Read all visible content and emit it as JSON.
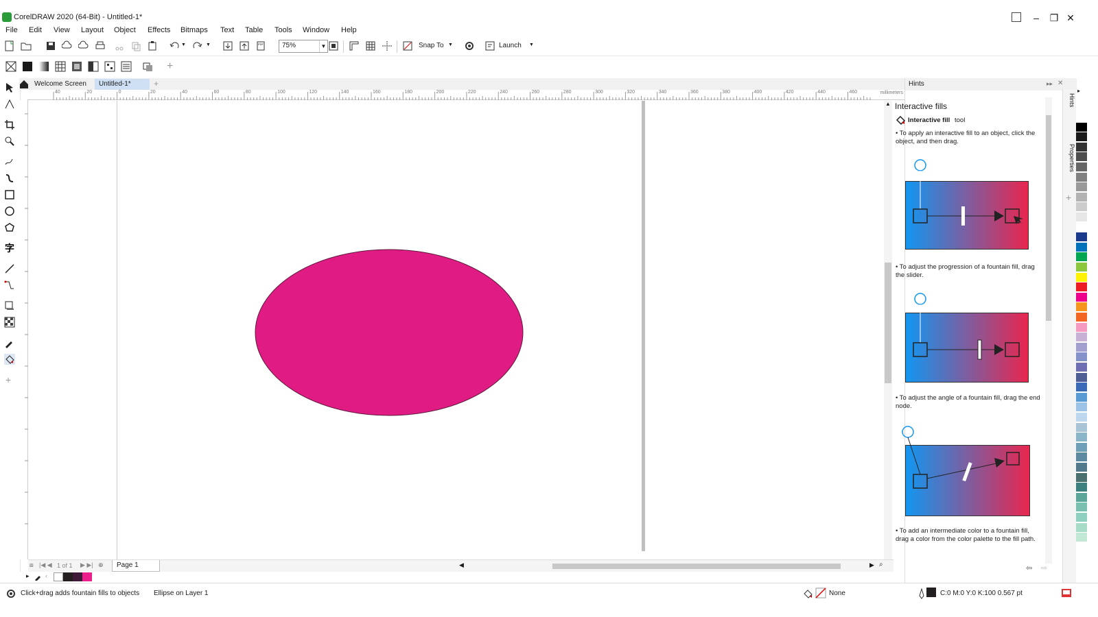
{
  "window": {
    "title": "CorelDRAW 2020 (64-Bit) - Untitled-1*",
    "buttons": [
      "–",
      "❐",
      "✕"
    ]
  },
  "menu": [
    "File",
    "Edit",
    "View",
    "Layout",
    "Object",
    "Effects",
    "Bitmaps",
    "Text",
    "Table",
    "Tools",
    "Window",
    "Help"
  ],
  "toolbar": {
    "zoom": "75%",
    "snap_label": "Snap To",
    "launch_label": "Launch"
  },
  "tabs": {
    "welcome": "Welcome Screen",
    "doc": "Untitled-1*",
    "add": "+"
  },
  "ruler": {
    "unit": "millimeters",
    "h_ticks": [
      "40",
      "20",
      "0",
      "20",
      "40",
      "60",
      "80",
      "100",
      "120",
      "140",
      "160",
      "180",
      "200",
      "220",
      "240",
      "260",
      "280",
      "300",
      "320",
      "340",
      "360",
      "380",
      "400",
      "420",
      "440",
      "460"
    ]
  },
  "hints": {
    "panel_title": "Hints",
    "heading": "Interactive fills",
    "tool_name": "Interactive fill",
    "tool_suffix": "tool",
    "bullet1": "• To apply an interactive fill to an object, click the object, and then drag.",
    "bullet2": "• To adjust the progression of a fountain fill, drag the slider.",
    "bullet3": "• To adjust the angle of a fountain fill, drag the end node.",
    "bullet4": "• To add an intermediate color to a fountain fill, drag a color from the color palette to the fill path."
  },
  "sidetabs": {
    "hints": "Hints",
    "properties": "Properties"
  },
  "pages": {
    "counter": "1 of 1",
    "page": "Page 1"
  },
  "status": {
    "hint": "Click+drag adds fountain fills to objects",
    "selection": "Ellipse on Layer 1",
    "fill": "None",
    "outline": "C:0 M:0 Y:0 K:100  0.567 pt"
  },
  "colors": {
    "ellipse": "#e01b84",
    "palette": [
      "#ffffff",
      "#000000",
      "#1a1a1a",
      "#333333",
      "#4d4d4d",
      "#666666",
      "#808080",
      "#999999",
      "#b3b3b3",
      "#cccccc",
      "#e6e6e6",
      "#ffffff",
      "#1b3a8c",
      "#0072bc",
      "#00a651",
      "#8dc63f",
      "#fff200",
      "#ed1c24",
      "#ec008c",
      "#f7941d",
      "#f26522",
      "#f49ac1",
      "#c7b2d6",
      "#a3a0cf",
      "#8393ca",
      "#6d6fb2",
      "#4e5f96",
      "#3a6ab8",
      "#5b9bd5",
      "#9dc3e6",
      "#bdd7ee",
      "#a9c4d6",
      "#8ab4c8",
      "#6fa0b8",
      "#5d8aa0",
      "#527a8c",
      "#4a7070",
      "#3d8080",
      "#5ba59a",
      "#7ac0b0",
      "#8fd0c0",
      "#a8dcc8",
      "#c0e8d4"
    ],
    "doc_palette": [
      "#ffffff",
      "#231f20",
      "#3c1a38",
      "#ec1e8c"
    ]
  }
}
